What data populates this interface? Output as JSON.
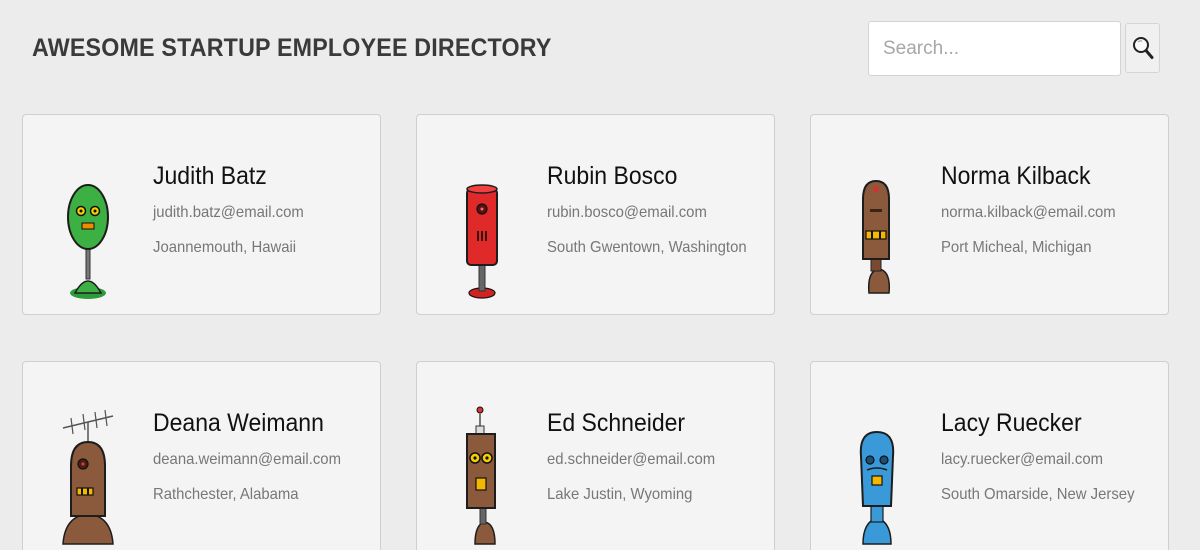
{
  "header": {
    "title": "AWESOME STARTUP EMPLOYEE DIRECTORY"
  },
  "search": {
    "placeholder": "Search...",
    "icon": "magnifying-glass-icon"
  },
  "employees": [
    {
      "name": "Judith Batz",
      "email": "judith.batz@email.com",
      "location": "Joannemouth, Hawaii",
      "avatar": "green-egg-robot",
      "avatar_color": "#3cb043"
    },
    {
      "name": "Rubin Bosco",
      "email": "rubin.bosco@email.com",
      "location": "South Gwentown, Washington",
      "avatar": "red-cylinder-robot",
      "avatar_color": "#e02a2a"
    },
    {
      "name": "Norma Kilback",
      "email": "norma.kilback@email.com",
      "location": "Port Micheal, Michigan",
      "avatar": "brown-robot",
      "avatar_color": "#8b5a3c"
    },
    {
      "name": "Deana Weimann",
      "email": "deana.weimann@email.com",
      "location": "Rathchester, Alabama",
      "avatar": "brown-antenna-robot",
      "avatar_color": "#8b5a3c"
    },
    {
      "name": "Ed Schneider",
      "email": "ed.schneider@email.com",
      "location": "Lake Justin, Wyoming",
      "avatar": "brown-box-robot",
      "avatar_color": "#8b5a3c"
    },
    {
      "name": "Lacy Ruecker",
      "email": "lacy.ruecker@email.com",
      "location": "South Omarside, New Jersey",
      "avatar": "blue-robot",
      "avatar_color": "#3a9ad9"
    }
  ]
}
